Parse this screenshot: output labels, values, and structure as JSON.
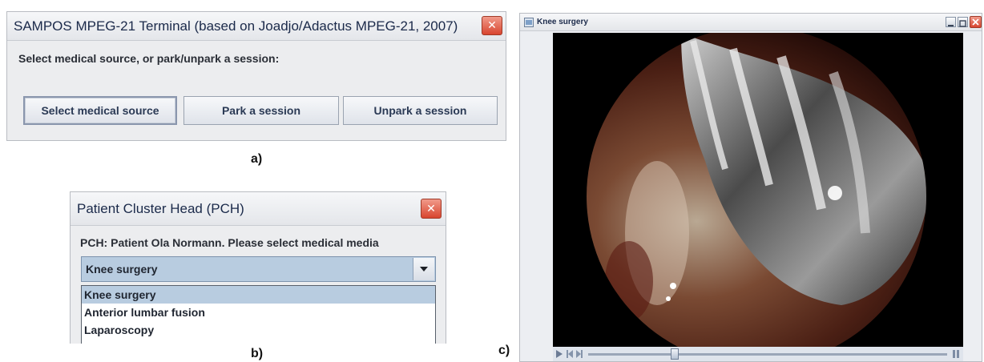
{
  "window_a": {
    "title": "SAMPOS MPEG-21 Terminal (based on Joadjo/Adactus MPEG-21, 2007)",
    "instruction": "Select medical source, or park/unpark a session:",
    "buttons": [
      "Select medical source",
      "Park a session",
      "Unpark a session"
    ],
    "close_glyph": "✕"
  },
  "window_b": {
    "title": "Patient Cluster Head (PCH)",
    "instruction": "PCH: Patient Ola Normann. Please select medical media",
    "combo_value": "Knee surgery",
    "dropdown_options": [
      "Knee surgery",
      "Anterior lumbar fusion",
      "Laparoscopy"
    ],
    "close_glyph": "✕"
  },
  "window_c": {
    "title": "Knee surgery",
    "slider_position": 0.24
  },
  "captions": {
    "a": "a)",
    "b": "b)",
    "c": "c)"
  },
  "colors": {
    "selection": "#b8cce0",
    "close_red": "#d8452f",
    "title_text": "#1b2a4a"
  }
}
